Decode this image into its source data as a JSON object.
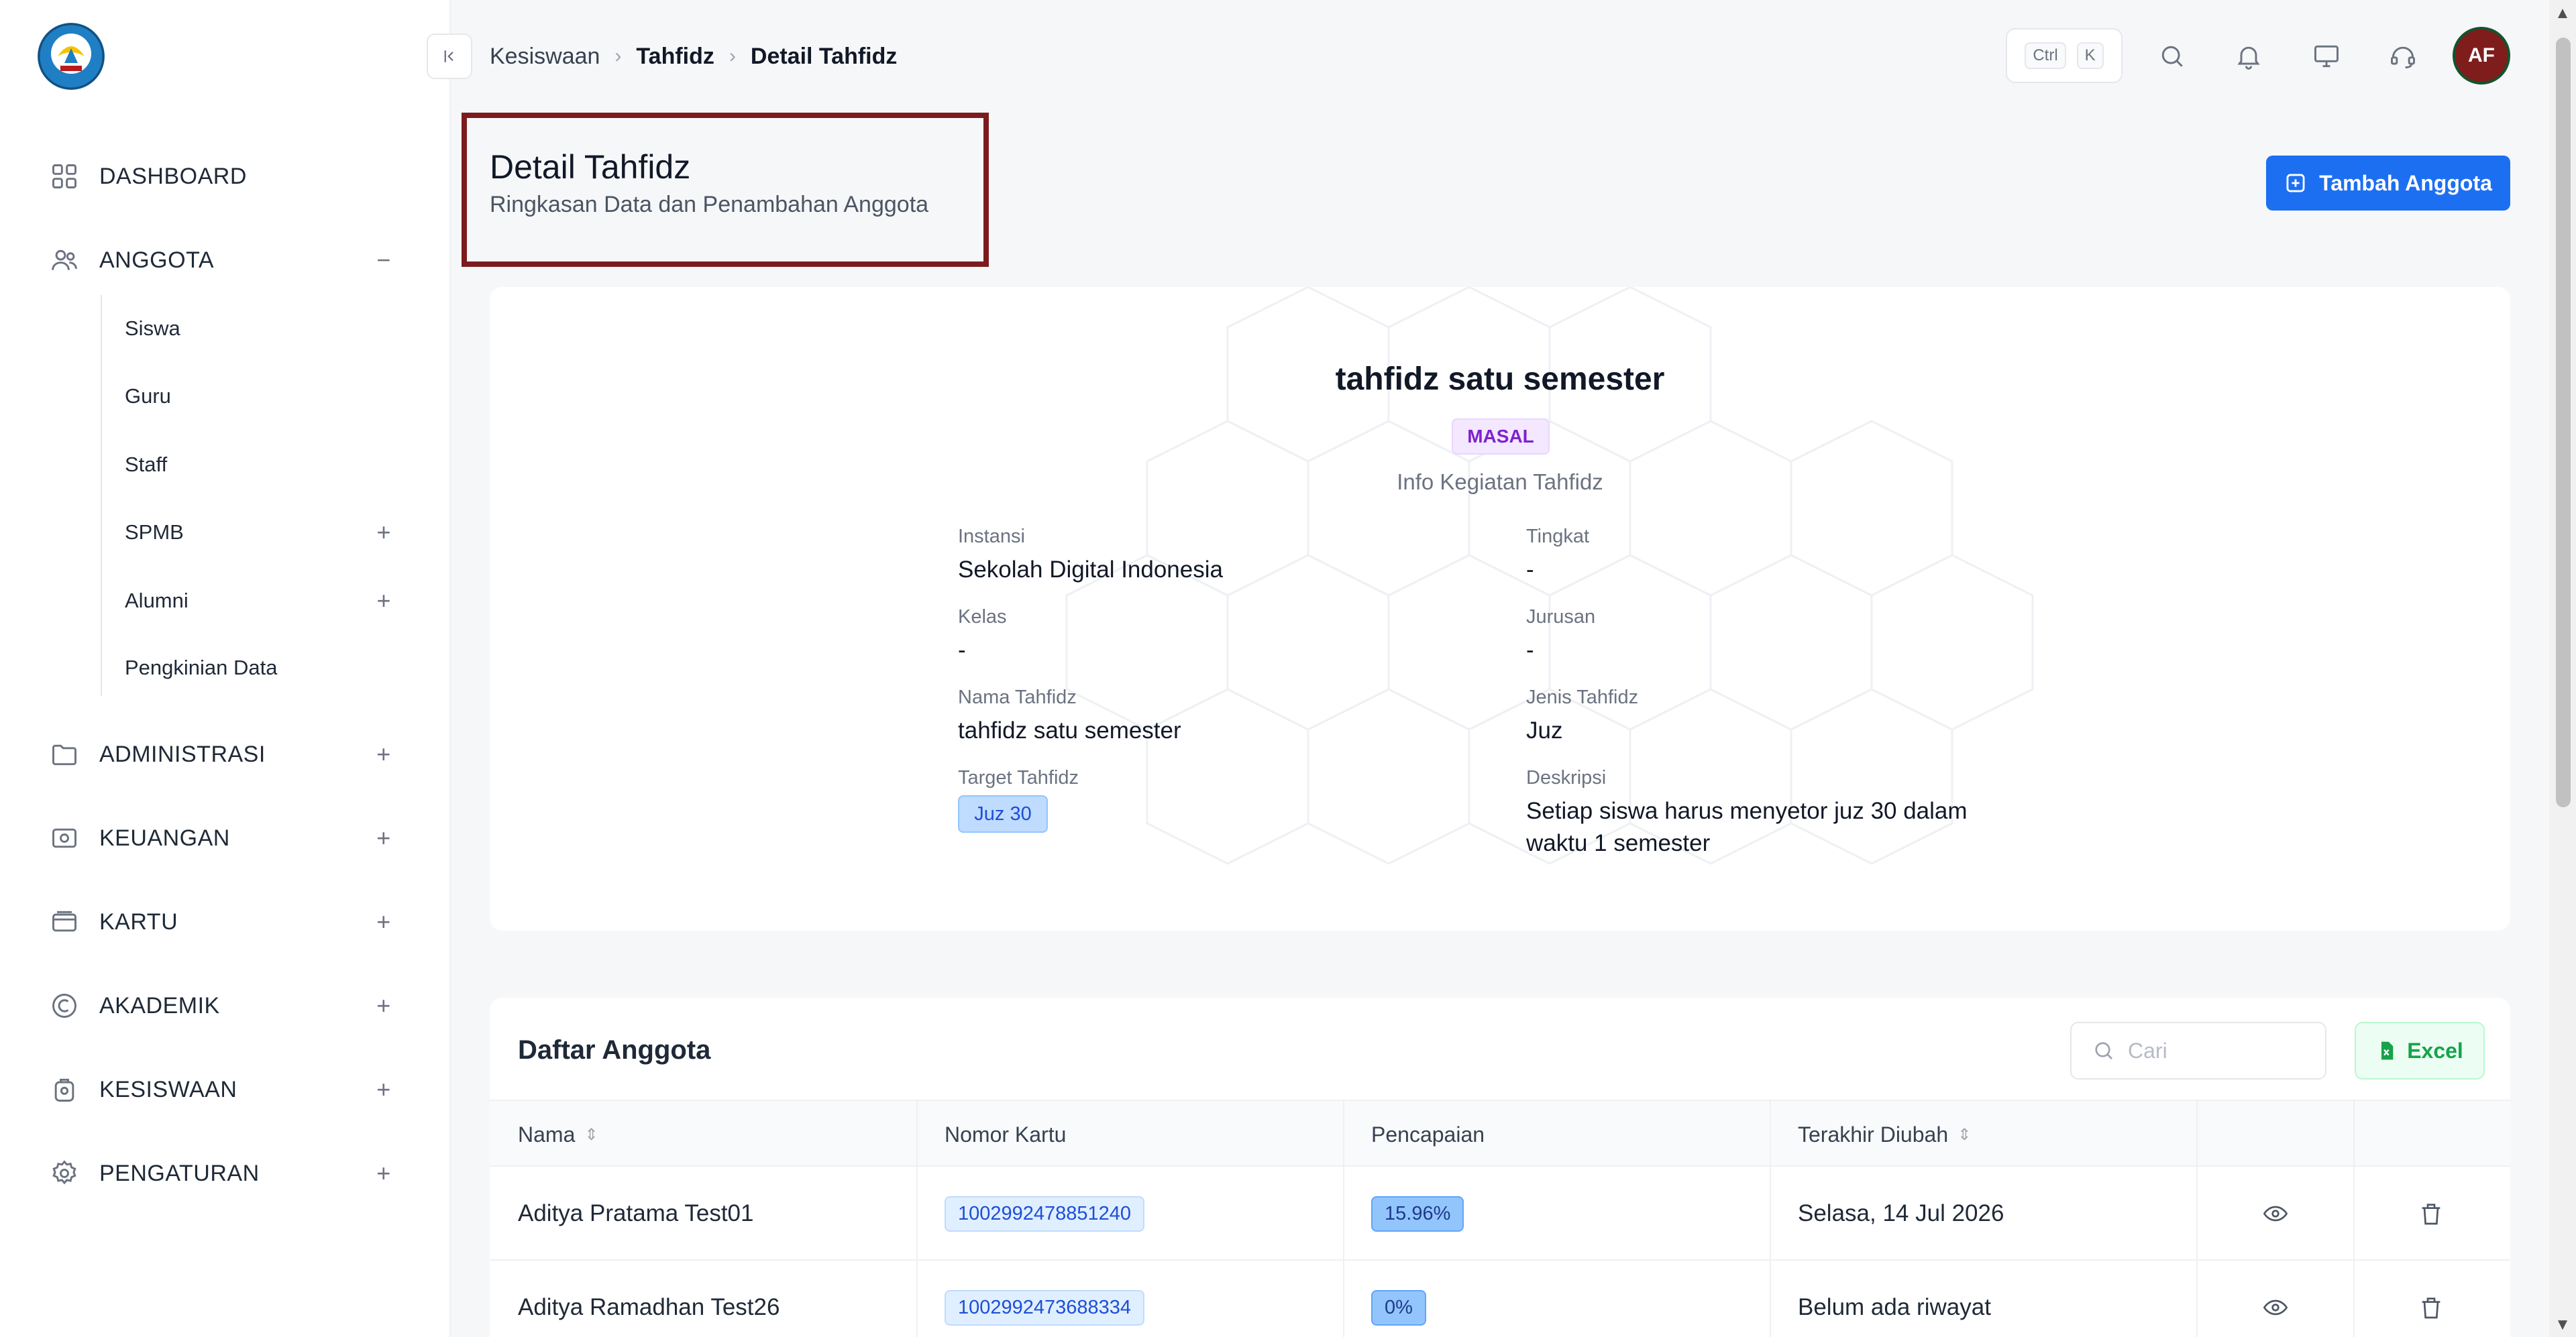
{
  "sidebar": {
    "logo": "tut-wuri-handayani-logo",
    "items": [
      {
        "label": "DASHBOARD",
        "icon": "grid-icon",
        "toggle": ""
      },
      {
        "label": "ANGGOTA",
        "icon": "users-icon",
        "toggle": "−"
      },
      {
        "label": "ADMINISTRASI",
        "icon": "folder-icon",
        "toggle": "+"
      },
      {
        "label": "KEUANGAN",
        "icon": "money-icon",
        "toggle": "+"
      },
      {
        "label": "KARTU",
        "icon": "card-icon",
        "toggle": "+"
      },
      {
        "label": "AKADEMIK",
        "icon": "academic-icon",
        "toggle": "+"
      },
      {
        "label": "KESISWAAN",
        "icon": "student-icon",
        "toggle": "+"
      },
      {
        "label": "PENGATURAN",
        "icon": "gear-icon",
        "toggle": "+"
      }
    ],
    "sub_items": [
      {
        "label": "Siswa",
        "toggle": ""
      },
      {
        "label": "Guru",
        "toggle": ""
      },
      {
        "label": "Staff",
        "toggle": ""
      },
      {
        "label": "SPMB",
        "toggle": "+"
      },
      {
        "label": "Alumni",
        "toggle": "+"
      },
      {
        "label": "Pengkinian Data",
        "toggle": ""
      }
    ]
  },
  "topbar": {
    "breadcrumb": [
      "Kesiswaan",
      "Tahfidz",
      "Detail Tahfidz"
    ],
    "shortcut_keys": [
      "Ctrl",
      "K"
    ],
    "avatar_initials": "AF"
  },
  "page": {
    "title": "Detail Tahfidz",
    "subtitle": "Ringkasan Data dan Penambahan Anggota",
    "add_button": "Tambah Anggota"
  },
  "info_card": {
    "title": "tahfidz satu semester",
    "badge": "MASAL",
    "subtitle": "Info Kegiatan Tahfidz",
    "fields": {
      "instansi_label": "Instansi",
      "instansi_value": "Sekolah Digital Indonesia",
      "tingkat_label": "Tingkat",
      "tingkat_value": "-",
      "kelas_label": "Kelas",
      "kelas_value": "-",
      "jurusan_label": "Jurusan",
      "jurusan_value": "-",
      "nama_label": "Nama Tahfidz",
      "nama_value": "tahfidz satu semester",
      "jenis_label": "Jenis Tahfidz",
      "jenis_value": "Juz",
      "target_label": "Target Tahfidz",
      "target_value": "Juz 30",
      "deskripsi_label": "Deskripsi",
      "deskripsi_line1": "Setiap siswa harus menyetor juz 30 dalam",
      "deskripsi_line2": "waktu 1 semester"
    }
  },
  "members_table": {
    "title": "Daftar Anggota",
    "search_placeholder": "Cari",
    "excel_button": "Excel",
    "columns": [
      "Nama",
      "Nomor Kartu",
      "Pencapaian",
      "Terakhir Diubah"
    ],
    "rows": [
      {
        "nama": "Aditya Pratama Test01",
        "nomor_kartu": "1002992478851240",
        "pencapaian": "15.96%",
        "terakhir_diubah": "Selasa, 14 Jul 2026"
      },
      {
        "nama": "Aditya Ramadhan Test26",
        "nomor_kartu": "1002992473688334",
        "pencapaian": "0%",
        "terakhir_diubah": "Belum ada riwayat"
      }
    ]
  },
  "colors": {
    "primary": "#1d6ff2",
    "highlight_border": "#7b1b1e",
    "badge_purple": "#7e22ce",
    "excel_green": "#16a34a"
  }
}
